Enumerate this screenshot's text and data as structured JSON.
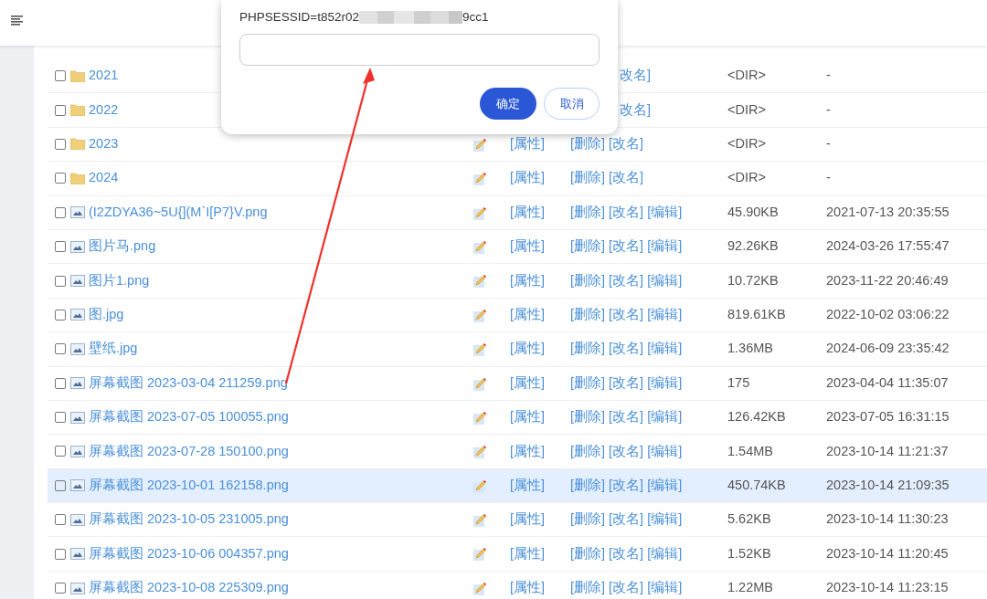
{
  "dialog": {
    "session_label": "PHPSESSID=t852r02",
    "session_tail": "9cc1",
    "confirm": "确定",
    "cancel": "取消"
  },
  "rows": [
    {
      "kind": "folder",
      "name": "2021",
      "ops": [
        "改名]"
      ],
      "size": "<DIR>",
      "date": "-",
      "selected": false
    },
    {
      "kind": "folder",
      "name": "2022",
      "ops": [
        "改名]"
      ],
      "size": "<DIR>",
      "date": "-",
      "selected": false
    },
    {
      "kind": "folder",
      "name": "2023",
      "props": "[属性]",
      "ops": [
        "[删除]",
        "[改名]"
      ],
      "size": "<DIR>",
      "date": "-",
      "selected": false
    },
    {
      "kind": "folder",
      "name": "2024",
      "props": "[属性]",
      "ops": [
        "[删除]",
        "[改名]"
      ],
      "size": "<DIR>",
      "date": "-",
      "selected": false
    },
    {
      "kind": "image",
      "name": "(I2ZDYA36~5U{](M`I[P7}V.png",
      "props": "[属性]",
      "ops": [
        "[删除]",
        "[改名]",
        "[编辑]"
      ],
      "size": "45.90KB",
      "date": "2021-07-13 20:35:55",
      "selected": false
    },
    {
      "kind": "image",
      "name": "图片马.png",
      "props": "[属性]",
      "ops": [
        "[删除]",
        "[改名]",
        "[编辑]"
      ],
      "size": "92.26KB",
      "date": "2024-03-26 17:55:47",
      "selected": false
    },
    {
      "kind": "image",
      "name": "图片1.png",
      "props": "[属性]",
      "ops": [
        "[删除]",
        "[改名]",
        "[编辑]"
      ],
      "size": "10.72KB",
      "date": "2023-11-22 20:46:49",
      "selected": false
    },
    {
      "kind": "image",
      "name": "图.jpg",
      "props": "[属性]",
      "ops": [
        "[删除]",
        "[改名]",
        "[编辑]"
      ],
      "size": "819.61KB",
      "date": "2022-10-02 03:06:22",
      "selected": false
    },
    {
      "kind": "image",
      "name": "壁纸.jpg",
      "props": "[属性]",
      "ops": [
        "[删除]",
        "[改名]",
        "[编辑]"
      ],
      "size": "1.36MB",
      "date": "2024-06-09 23:35:42",
      "selected": false
    },
    {
      "kind": "image",
      "name": "屏幕截图 2023-03-04 211259.png",
      "props": "[属性]",
      "ops": [
        "[删除]",
        "[改名]",
        "[编辑]"
      ],
      "size": "175",
      "date": "2023-04-04 11:35:07",
      "selected": false
    },
    {
      "kind": "image",
      "name": "屏幕截图 2023-07-05 100055.png",
      "props": "[属性]",
      "ops": [
        "[删除]",
        "[改名]",
        "[编辑]"
      ],
      "size": "126.42KB",
      "date": "2023-07-05 16:31:15",
      "selected": false
    },
    {
      "kind": "image",
      "name": "屏幕截图 2023-07-28 150100.png",
      "props": "[属性]",
      "ops": [
        "[删除]",
        "[改名]",
        "[编辑]"
      ],
      "size": "1.54MB",
      "date": "2023-10-14 11:21:37",
      "selected": false
    },
    {
      "kind": "image",
      "name": "屏幕截图 2023-10-01 162158.png",
      "props": "[属性]",
      "ops": [
        "[删除]",
        "[改名]",
        "[编辑]"
      ],
      "size": "450.74KB",
      "date": "2023-10-14 21:09:35",
      "selected": true
    },
    {
      "kind": "image",
      "name": "屏幕截图 2023-10-05 231005.png",
      "props": "[属性]",
      "ops": [
        "[删除]",
        "[改名]",
        "[编辑]"
      ],
      "size": "5.62KB",
      "date": "2023-10-14 11:30:23",
      "selected": false
    },
    {
      "kind": "image",
      "name": "屏幕截图 2023-10-06 004357.png",
      "props": "[属性]",
      "ops": [
        "[删除]",
        "[改名]",
        "[编辑]"
      ],
      "size": "1.52KB",
      "date": "2023-10-14 11:20:45",
      "selected": false
    },
    {
      "kind": "image",
      "name": "屏幕截图 2023-10-08 225309.png",
      "props": "[属性]",
      "ops": [
        "[删除]",
        "[改名]",
        "[编辑]"
      ],
      "size": "1.22MB",
      "date": "2023-10-14 11:23:15",
      "selected": false
    }
  ]
}
